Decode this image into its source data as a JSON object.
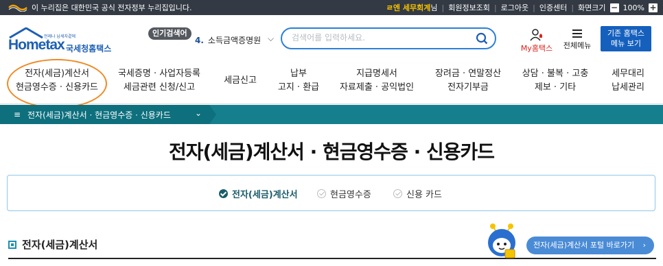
{
  "govbar": {
    "text": "이 누리집은 대한민국 공식 전자정부 누리집입니다.",
    "user_name": "ㄹ엔 세무회계",
    "user_suffix": "님",
    "links": [
      "회원정보조회",
      "로그아웃",
      "인증센터",
      "화면크기"
    ],
    "zoom": "100%"
  },
  "header": {
    "logo_text": "Hometax",
    "logo_korean": "국세청홈택스",
    "logo_small": "언제나 납세자곁에",
    "popular_badge": "인기검색어",
    "popular_rank": "4.",
    "popular_term": "소득금액증명원",
    "search_placeholder": "검색어를 입력하세요.",
    "my_home": "My홈택스",
    "all_menu": "전체메뉴",
    "old_menu_line1": "기존 홈택스",
    "old_menu_line2": "메뉴 보기"
  },
  "gnb": [
    {
      "line1": "전자(세금)계산서",
      "line2": "현금영수증 · 신용카드"
    },
    {
      "line1": "국세증명 · 사업자등록",
      "line2": "세금관련 신청/신고"
    },
    {
      "line1": "세금신고",
      "line2": ""
    },
    {
      "line1": "납부",
      "line2": "고지 · 환급"
    },
    {
      "line1": "지급명세서",
      "line2": "자료제출 · 공익법인"
    },
    {
      "line1": "장려금 · 연말정산",
      "line2": "전자기부금"
    },
    {
      "line1": "상담 · 불복 · 고충",
      "line2": "제보 · 기타"
    },
    {
      "line1": "세무대리",
      "line2": "납세관리"
    }
  ],
  "breadcrumb": {
    "label": "전자(세금)계산서 · 현금영수증 · 신용카드"
  },
  "page_title": "전자(세금)계산서 · 현금영수증 · 신용카드",
  "tabs": [
    {
      "label": "전자(세금)계산서",
      "active": true
    },
    {
      "label": "현금영수증",
      "active": false
    },
    {
      "label": "신용 카드",
      "active": false
    }
  ],
  "section_title": "전자(세금)계산서",
  "portal_button": "전자(세금)계산서 포털 바로가기",
  "colors": {
    "brand": "#1d5fb4",
    "teal": "#157f8e",
    "accent_orange": "#f08a24",
    "old_menu": "#1560bd"
  },
  "icons": [
    "gov-flag-icon",
    "search-icon",
    "my-home-icon",
    "hamburger-icon",
    "chevron-down-icon",
    "check-circle-icon",
    "chevron-right-icon"
  ]
}
